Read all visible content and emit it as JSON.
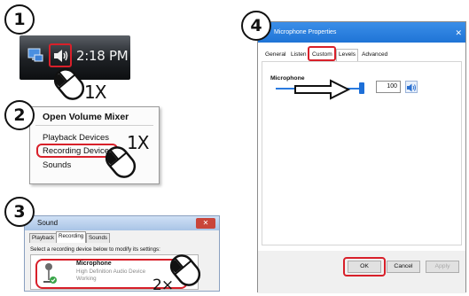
{
  "steps": [
    "1",
    "2",
    "3",
    "4"
  ],
  "panel1": {
    "clock_time": "2:18 PM",
    "click_count": "1X",
    "icons": [
      "network-icon",
      "speaker-icon"
    ]
  },
  "panel2": {
    "menu_items": [
      "Open Volume Mixer",
      "Playback Devices",
      "Recording Devices",
      "Sounds"
    ],
    "click_count": "1X"
  },
  "panel3": {
    "window_title": "Sound",
    "tabs": [
      "Playback",
      "Recording",
      "Sounds"
    ],
    "instruction": "Select a recording device below to modify its settings:",
    "device_name": "Microphone",
    "device_description": "High Definition Audio Device",
    "device_status": "Working",
    "click_count": "2×"
  },
  "panel4": {
    "window_title": "Microphone Properties",
    "tabs": [
      "General",
      "Listen",
      "Custom",
      "Levels",
      "Advanced"
    ],
    "section_label": "Microphone",
    "level_value": "100",
    "level_fraction": 1.0,
    "buttons": {
      "ok": "OK",
      "cancel": "Cancel",
      "apply": "Apply"
    }
  },
  "colors": {
    "highlight": "#d8202a",
    "title_bar": "#2a7be0"
  }
}
